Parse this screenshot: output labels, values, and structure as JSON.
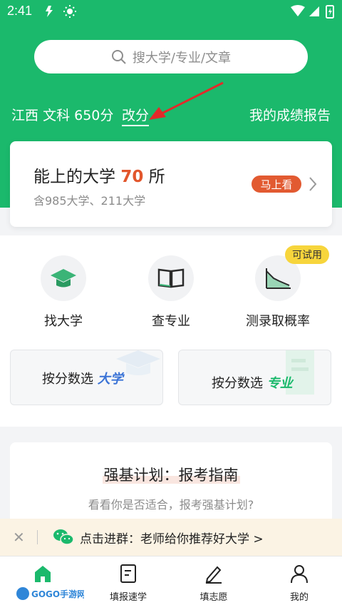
{
  "status_bar": {
    "time": "2:41"
  },
  "search": {
    "placeholder": "搜大学/专业/文章"
  },
  "profile": {
    "province": "江西",
    "track": "文科",
    "score": "650分",
    "change_score_label": "改分",
    "report_label": "我的成绩报告"
  },
  "university_card": {
    "title_prefix": "能上的大学",
    "count": "70",
    "title_suffix": "所",
    "subtitle": "含985大学、211大学",
    "action_label": "马上看"
  },
  "features": [
    {
      "label": "找大学",
      "icon": "graduation-cap-icon"
    },
    {
      "label": "查专业",
      "icon": "open-book-icon"
    },
    {
      "label": "测录取概率",
      "icon": "chart-icon",
      "badge": "可试用"
    }
  ],
  "select_cards": [
    {
      "label": "按分数选",
      "accent": "大学"
    },
    {
      "label": "按分数选",
      "accent": "专业"
    }
  ],
  "strong_base": {
    "title": "强基计划：报考指南",
    "subtitle": "看看你是否适合，报考强基计划?"
  },
  "banner": {
    "text": "点击进群：老师给你推荐好大学 >"
  },
  "bottom_nav": [
    {
      "label": "",
      "icon": "home-icon"
    },
    {
      "label": "填报速学",
      "icon": "document-icon"
    },
    {
      "label": "填志愿",
      "icon": "pen-icon"
    },
    {
      "label": "我的",
      "icon": "person-icon"
    }
  ],
  "watermark": {
    "text": "GOGO手游网"
  },
  "colors": {
    "primary": "#1bb96c",
    "accent": "#e25a31",
    "badge": "#f7d53c"
  }
}
